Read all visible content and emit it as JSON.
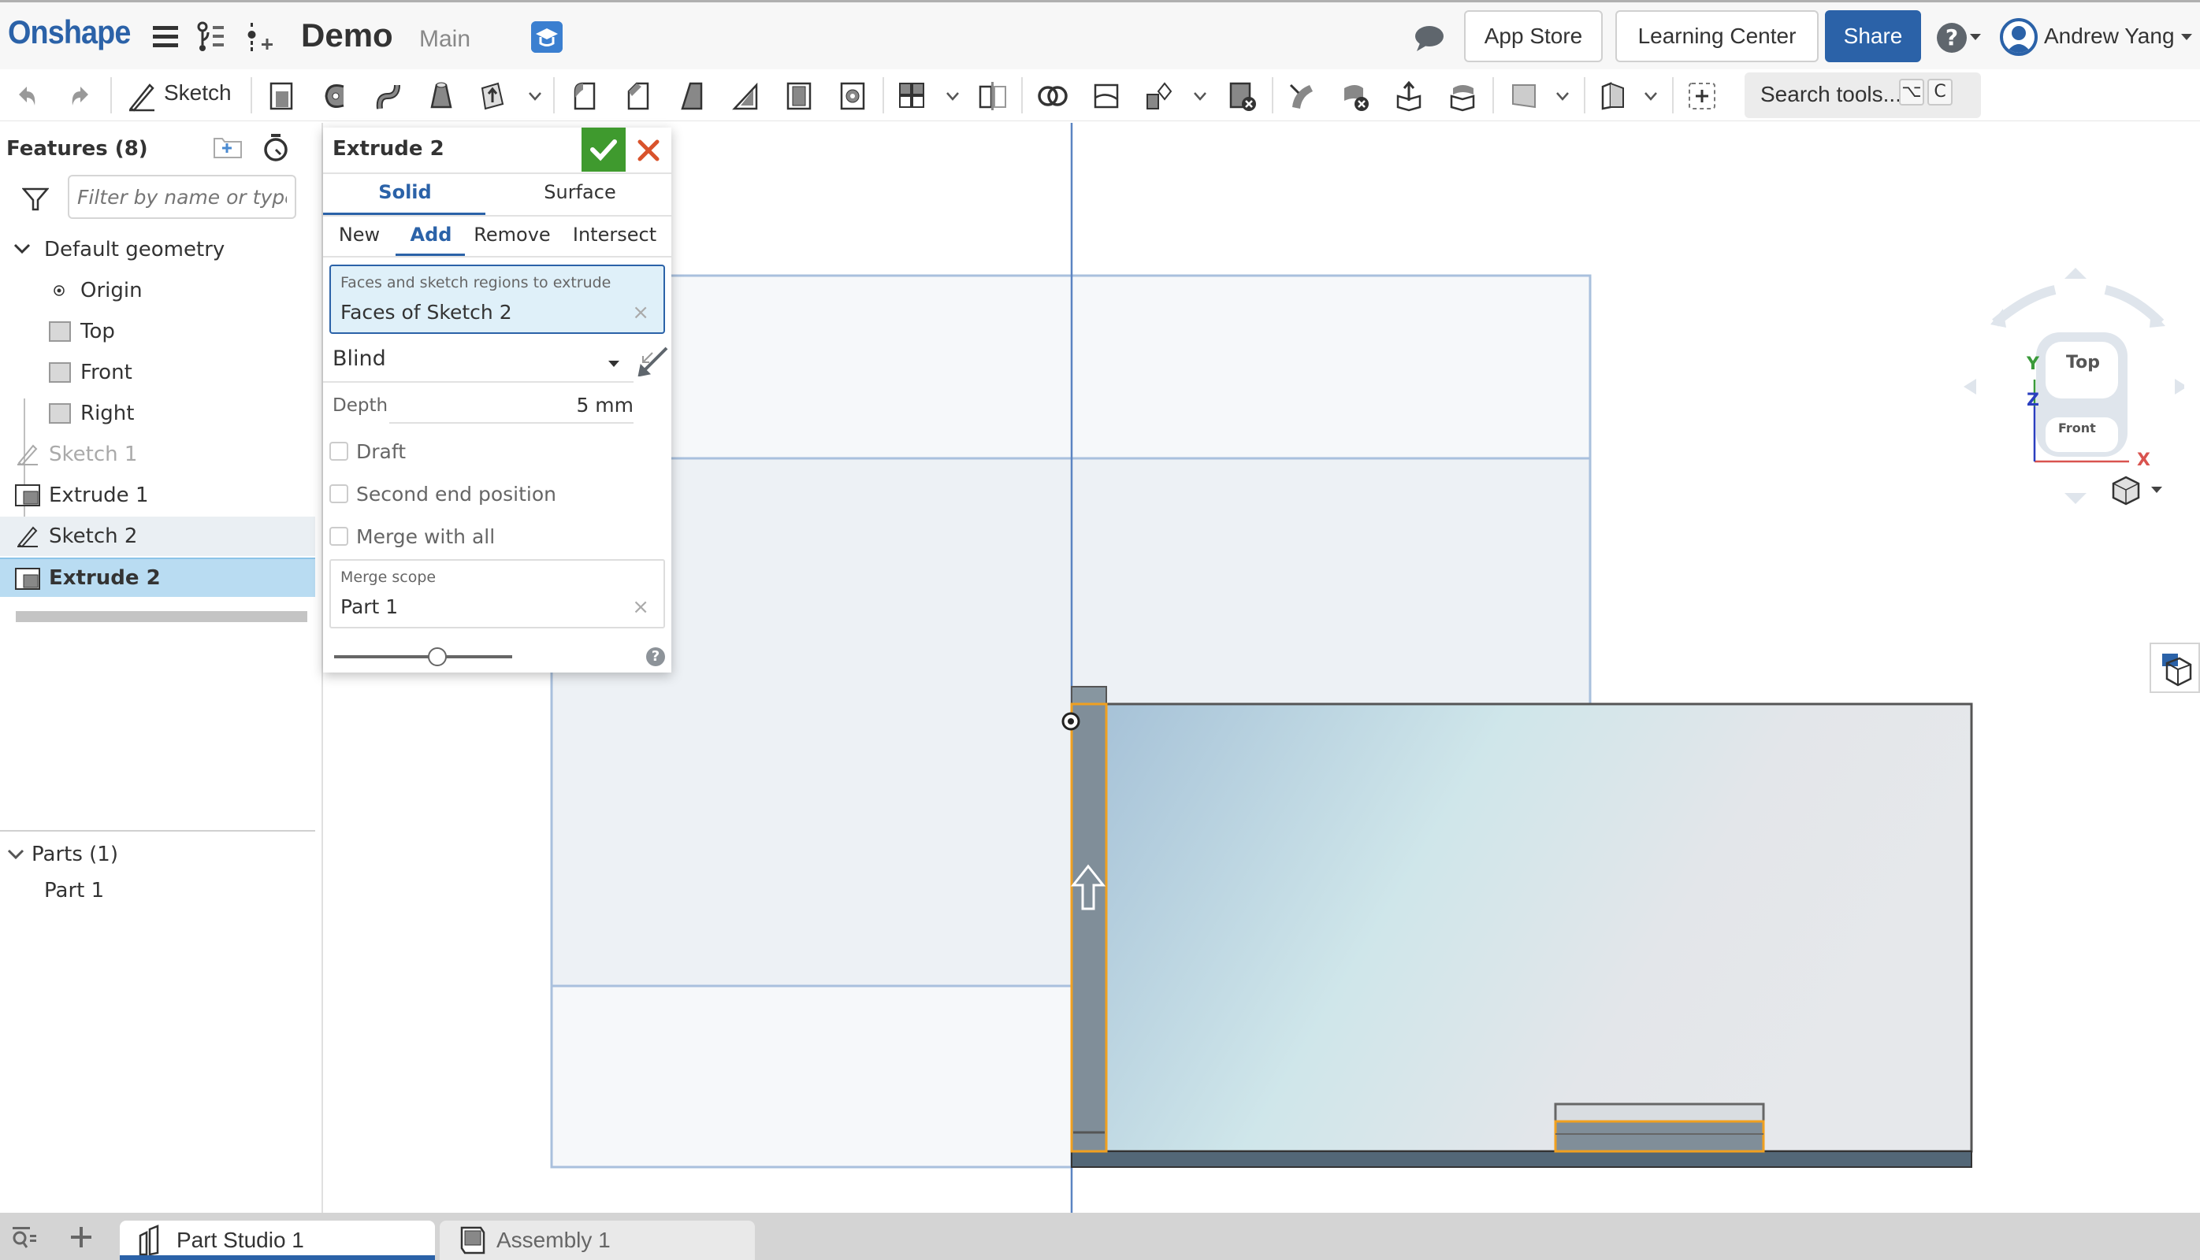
{
  "header": {
    "logo": "Onshape",
    "document_title": "Demo",
    "branch": "Main",
    "buttons": {
      "app_store": "App Store",
      "learning_center": "Learning Center",
      "share": "Share"
    },
    "help_glyph": "?",
    "user_name": "Andrew Yang",
    "icons": [
      "menu-icon",
      "version-graph-icon",
      "insert-icon",
      "learning-badge-icon",
      "chat-icon",
      "help-icon",
      "avatar-icon"
    ]
  },
  "toolbar": {
    "sketch_label": "Sketch",
    "search_placeholder": "Search tools...",
    "shortcut_keys": [
      "⌥",
      "C"
    ],
    "tools": [
      "undo",
      "redo",
      "sketch",
      "extrude",
      "revolve",
      "sweep",
      "loft",
      "thicken",
      "fillet",
      "chamfer",
      "draft",
      "rib",
      "shell",
      "hole",
      "linear-pattern",
      "mirror",
      "boolean",
      "split",
      "transform",
      "delete-part",
      "modify-fillet",
      "delete-face",
      "move-face",
      "replace-face",
      "plane",
      "mate-connector",
      "add-custom-feature"
    ]
  },
  "features_panel": {
    "title": "Features (8)",
    "filter_placeholder": "Filter by name or type",
    "default_geometry_label": "Default geometry",
    "default_geometry": [
      {
        "label": "Origin",
        "icon": "origin-icon"
      },
      {
        "label": "Top",
        "icon": "plane-icon"
      },
      {
        "label": "Front",
        "icon": "plane-icon"
      },
      {
        "label": "Right",
        "icon": "plane-icon"
      }
    ],
    "features": [
      {
        "label": "Sketch 1",
        "icon": "sketch-icon",
        "state": "hidden"
      },
      {
        "label": "Extrude 1",
        "icon": "extrude-icon",
        "state": "normal"
      },
      {
        "label": "Sketch 2",
        "icon": "sketch-icon",
        "state": "hover"
      },
      {
        "label": "Extrude 2",
        "icon": "extrude-icon",
        "state": "selected"
      }
    ],
    "parts_header": "Parts (1)",
    "parts": [
      "Part 1"
    ]
  },
  "extrude_dialog": {
    "title": "Extrude 2",
    "body_tabs": [
      "Solid",
      "Surface"
    ],
    "active_body_tab": "Solid",
    "op_tabs": [
      "New",
      "Add",
      "Remove",
      "Intersect"
    ],
    "active_op_tab": "Add",
    "faces_caption": "Faces and sketch regions to extrude",
    "faces_value": "Faces of Sketch 2",
    "end_type": "Blind",
    "depth_label": "Depth",
    "depth_value": "5 mm",
    "checkboxes": [
      {
        "label": "Draft",
        "checked": false
      },
      {
        "label": "Second end position",
        "checked": false
      },
      {
        "label": "Merge with all",
        "checked": false
      }
    ],
    "merge_scope_caption": "Merge scope",
    "merge_scope_value": "Part 1",
    "clear_glyph": "×",
    "help_glyph": "?",
    "preview_slider_fraction": 0.58
  },
  "view_cube": {
    "faces": [
      "Top",
      "Front"
    ],
    "axes": [
      "X",
      "Y",
      "Z"
    ],
    "axis_colors": {
      "X": "#d9534f",
      "Y": "#3a9a3a",
      "Z": "#2a3fbf"
    }
  },
  "viewport": {
    "plane_label": "Front",
    "selection_color": "#f0a020",
    "part_color": "#a3bfd6"
  },
  "bottom_tabs": {
    "tabs": [
      {
        "label": "Part Studio 1",
        "active": true
      },
      {
        "label": "Assembly 1",
        "active": false
      }
    ]
  },
  "colors": {
    "brand": "#2b62a8",
    "accept": "#3f9a2e",
    "cancel": "#d9532c",
    "selected_row": "#b9dcf2"
  }
}
